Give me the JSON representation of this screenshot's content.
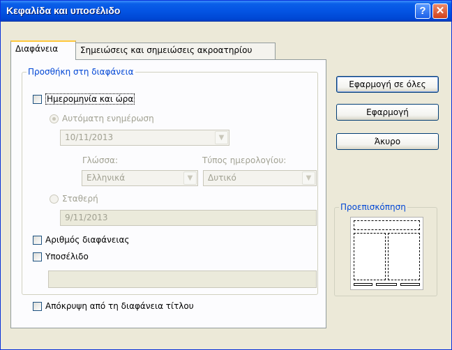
{
  "window": {
    "title": "Κεφαλίδα και υποσέλιδο",
    "help_symbol": "?",
    "close_symbol": "✕"
  },
  "tabs": [
    {
      "label": "Διαφάνεια",
      "active": true
    },
    {
      "label": "Σημειώσεις και σημειώσεις ακροατηρίου",
      "active": false
    }
  ],
  "slide_group": {
    "legend": "Προσθήκη στη διαφάνεια",
    "date_time_label": "Ημερομηνία και ώρα",
    "auto_update_label": "Αυτόματη ενημέρωση",
    "auto_date_value": "10/11/2013",
    "language_label": "Γλώσσα:",
    "language_value": "Ελληνικά",
    "calendar_label": "Τύπος ημερολογίου:",
    "calendar_value": "Δυτικό",
    "fixed_label": "Σταθερή",
    "fixed_date_value": "9/11/2013",
    "slide_number_label": "Αριθμός διαφάνειας",
    "footer_label": "Υποσέλιδο",
    "footer_value": ""
  },
  "hide_title_label": "Απόκρυψη από τη διαφάνεια τίτλου",
  "buttons": {
    "apply_all": "Εφαρμογή σε όλες",
    "apply": "Εφαρμογή",
    "cancel": "Άκυρο"
  },
  "preview": {
    "legend": "Προεπισκόπηση"
  },
  "icons": {
    "dropdown": "▼"
  }
}
